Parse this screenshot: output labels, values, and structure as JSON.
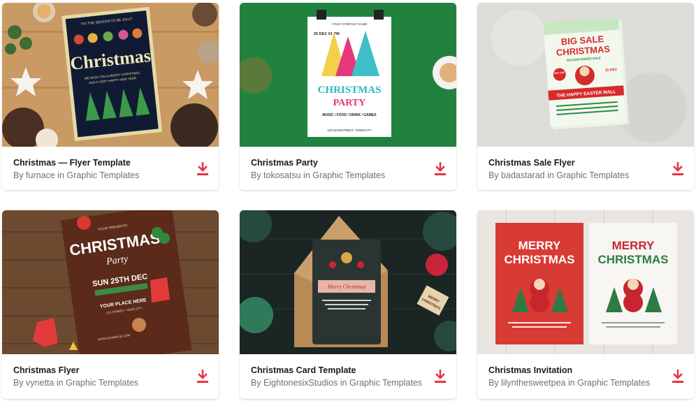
{
  "accent": "#e8334a",
  "cards": [
    {
      "title": "Christmas — Flyer Template",
      "author": "furnace",
      "category": "Graphic Templates",
      "byline": "By furnace in Graphic Templates",
      "thumb": {
        "top_line": "'TIS THE SEASON TO BE JOLLY",
        "word": "Christmas",
        "sub1": "WE WISH YOU A MERRY CHRISTMAS",
        "sub2": "AND A VERY HAPPY NEW YEAR"
      }
    },
    {
      "title": "Christmas Party",
      "author": "tokosatsu",
      "category": "Graphic Templates",
      "byline": "By tokosatsu in Graphic Templates",
      "thumb": {
        "company": "YOUR COMPANY NAME",
        "date": "20 DEC 01 PM",
        "word1": "CHRISTMAS",
        "word2": "PARTY",
        "line": "MUSIC / FOOD / DRINK / GAMES",
        "address": "123 MAINSTREET, TOWNCITY"
      }
    },
    {
      "title": "Christmas Sale Flyer",
      "author": "badastarad",
      "category": "Graphic Templates",
      "byline": "By badastarad in Graphic Templates",
      "thumb": {
        "word1": "BIG SALE",
        "word2": "CHRISTMAS",
        "sub": "SEASON ENDER SALE",
        "badge": "50% OFF",
        "date": "15 DEC",
        "mall": "THE HAPPY EASTER MALL"
      }
    },
    {
      "title": "Christmas Flyer",
      "author": "vynetta",
      "category": "Graphic Templates",
      "byline": "By vynetta in Graphic Templates",
      "thumb": {
        "presents": "YOUR PRESENTS",
        "word1": "CHRISTMAS",
        "word2": "Party",
        "date": "SUN 25TH DEC",
        "place1": "YOUR PLACE HERE",
        "place2": "123 STREET, YOUR CITY",
        "web": "WWW.EXAMPLE.COM"
      }
    },
    {
      "title": "Christmas Card Template",
      "author": "EightonesixStudios",
      "category": "Graphic Templates",
      "byline": "By EightonesixStudios in Graphic Templates",
      "thumb": {
        "banner": "Merry Christmas",
        "tag1": "MERRY",
        "tag2": "CHRISTMAS"
      }
    },
    {
      "title": "Christmas Invitation",
      "author": "lilynthesweetpea",
      "category": "Graphic Templates",
      "byline": "By lilynthesweetpea in Graphic Templates",
      "thumb": {
        "word1": "MERRY",
        "word2": "CHRISTMAS"
      }
    }
  ]
}
